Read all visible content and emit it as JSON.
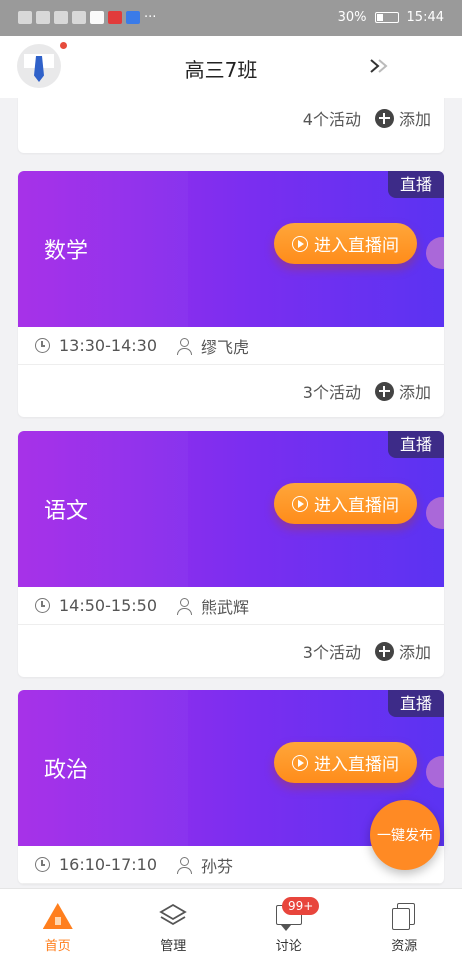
{
  "status_bar": {
    "battery": "30%",
    "time": "15:44"
  },
  "header": {
    "title": "高三7班"
  },
  "top_card": {
    "activity_count": "4个活动",
    "add_label": "添加"
  },
  "courses": [
    {
      "subject": "数学",
      "live_tag": "直播",
      "enter_label": "进入直播间",
      "time": "13:30-14:30",
      "teacher": "缪飞虎",
      "activity_count": "3个活动",
      "add_label": "添加"
    },
    {
      "subject": "语文",
      "live_tag": "直播",
      "enter_label": "进入直播间",
      "time": "14:50-15:50",
      "teacher": "熊武辉",
      "activity_count": "3个活动",
      "add_label": "添加"
    },
    {
      "subject": "政治",
      "live_tag": "直播",
      "enter_label": "进入直播间",
      "time": "16:10-17:10",
      "teacher": "孙芬"
    }
  ],
  "fab": {
    "label": "一键发布"
  },
  "bottom_nav": {
    "items": [
      {
        "label": "首页",
        "icon": "home-icon",
        "active": true
      },
      {
        "label": "管理",
        "icon": "layers-icon"
      },
      {
        "label": "讨论",
        "icon": "chat-icon",
        "badge": "99+"
      },
      {
        "label": "资源",
        "icon": "files-icon"
      }
    ]
  },
  "colors": {
    "accent": "#ff7f1e",
    "banner_start": "#a52ce8",
    "banner_end": "#5b33f2",
    "live_tag_bg": "#3d2b88",
    "badge": "#e8453c"
  }
}
